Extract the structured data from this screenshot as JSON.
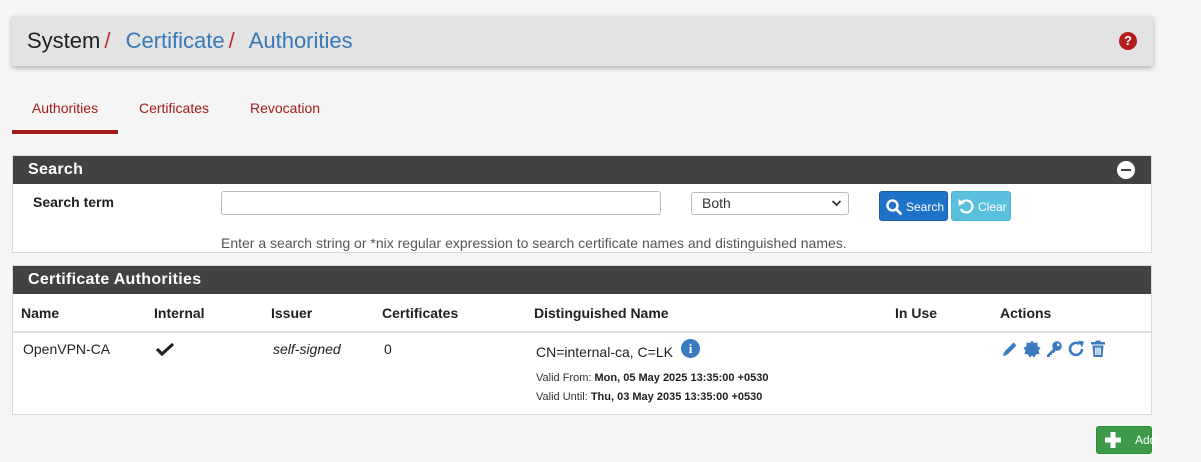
{
  "breadcrumb": {
    "root": "System",
    "sep": "/",
    "level1": "Certificate",
    "level2": "Authorities"
  },
  "tabs": [
    {
      "label": "Authorities",
      "active": true
    },
    {
      "label": "Certificates",
      "active": false
    },
    {
      "label": "Revocation",
      "active": false
    }
  ],
  "search": {
    "panel_title": "Search",
    "term_label": "Search term",
    "input_value": "",
    "select_value": "Both",
    "search_button": "Search",
    "clear_button": "Clear",
    "hint": "Enter a search string or *nix regular expression to search certificate names and distinguished names."
  },
  "ca_table": {
    "panel_title": "Certificate Authorities",
    "columns": [
      "Name",
      "Internal",
      "Issuer",
      "Certificates",
      "Distinguished Name",
      "In Use",
      "Actions"
    ],
    "rows": [
      {
        "name": "OpenVPN-CA",
        "internal": true,
        "issuer": "self-signed",
        "certificates": "0",
        "dn": "CN=internal-ca, C=LK",
        "valid_from_label": "Valid From:",
        "valid_from": "Mon, 05 May 2025 13:35:00 +0530",
        "valid_until_label": "Valid Until:",
        "valid_until": "Thu, 03 May 2035 13:35:00 +0530",
        "in_use": ""
      }
    ],
    "actions": [
      "edit-icon",
      "certificate-badge-icon",
      "key-icon",
      "renew-icon",
      "trash-icon"
    ]
  },
  "add_button": "Add",
  "colors": {
    "accent_red": "#a41b1b",
    "link_blue": "#3879b8",
    "panel_header": "#424242",
    "search_blue": "#1e73c9",
    "clear_cyan": "#5bc0de",
    "add_green": "#3c9a48"
  },
  "icons": {
    "help": "question-circle-icon",
    "collapse": "minus-circle-icon",
    "search": "magnifier-icon",
    "clear": "undo-icon",
    "info": "info-circle-icon",
    "add": "plus-icon",
    "check": "checkmark-icon"
  }
}
